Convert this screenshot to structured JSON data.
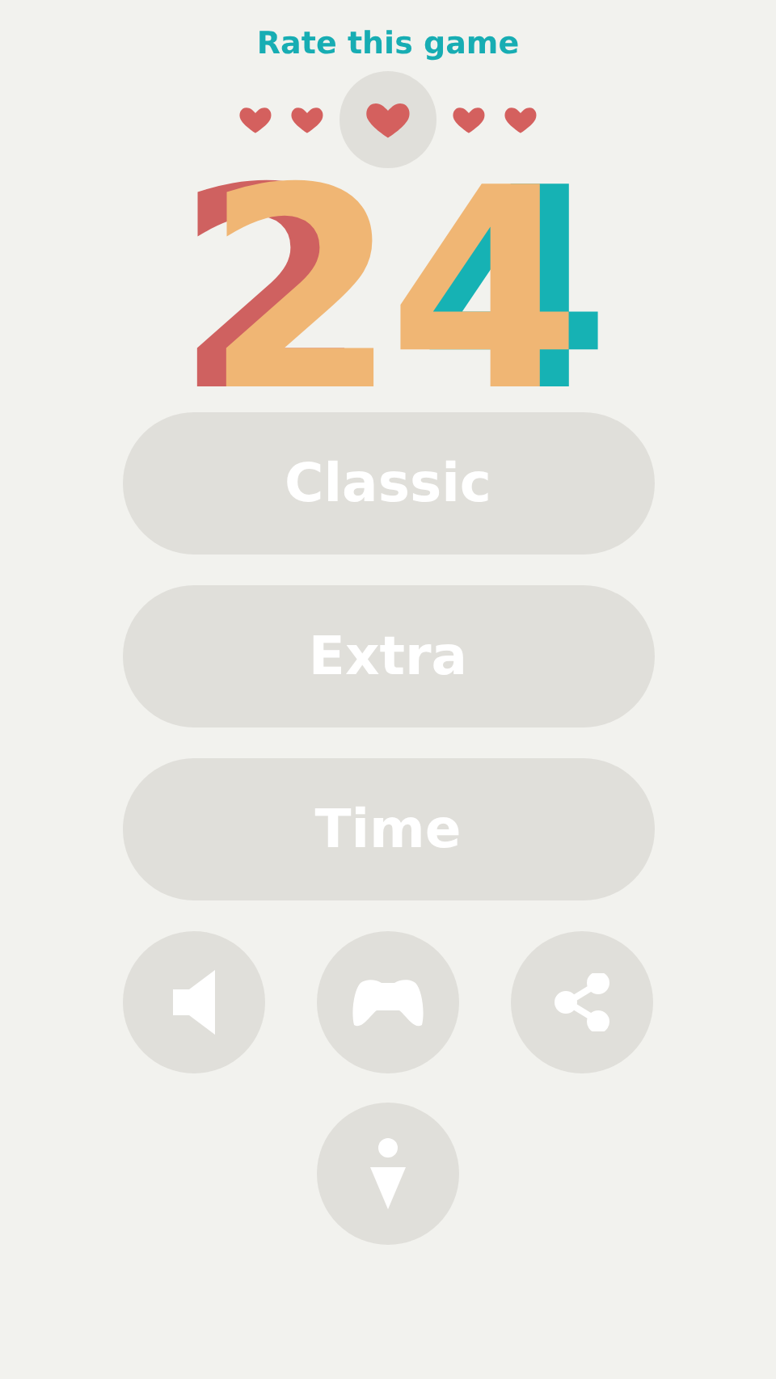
{
  "rating": {
    "title": "Rate this game",
    "hearts": [
      {
        "selected": false
      },
      {
        "selected": false
      },
      {
        "selected": true
      },
      {
        "selected": false
      },
      {
        "selected": false
      }
    ]
  },
  "logo": "24",
  "modes": [
    "Classic",
    "Extra",
    "Time"
  ],
  "icon_buttons": [
    {
      "kind": "sound"
    },
    {
      "kind": "gamepad"
    },
    {
      "kind": "share"
    },
    {
      "kind": "info"
    }
  ]
}
